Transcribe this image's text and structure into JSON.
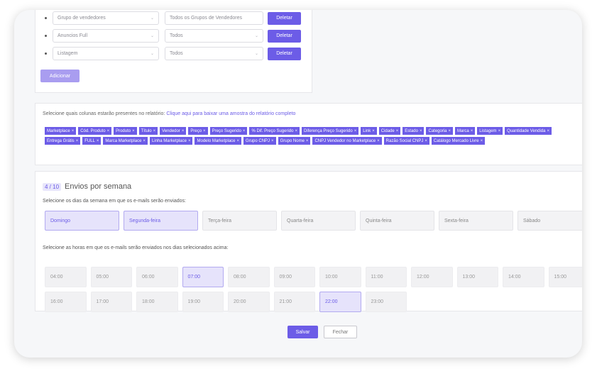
{
  "filters": [
    {
      "field": "Grupo de vendedores",
      "value": "Todos os Grupos de Vendedores",
      "delete_label": "Deletar"
    },
    {
      "field": "Anuncios Full",
      "value": "Todos",
      "delete_label": "Deletar"
    },
    {
      "field": "Listagem",
      "value": "Todos",
      "delete_label": "Deletar"
    }
  ],
  "add_label": "Adicionar",
  "columns": {
    "title": "Selecione quais colunas estarão presentes no relatório:",
    "link": "Clique aqui para baixar uma amostra do relatório completo",
    "tags": [
      "Marketplace",
      "Cód. Produto",
      "Produto",
      "Título",
      "Vendedor",
      "Preço",
      "Preço Sugerido",
      "% Dif. Preço Sugerido",
      "Diferença Preço Sugerido",
      "Link",
      "Cidade",
      "Estado",
      "Categoria",
      "Marca",
      "Listagem",
      "Quantidade Vendida",
      "Entrega Grátis",
      "FULL",
      "Marca Marketplace",
      "Linha Marketplace",
      "Modelo Marketplace",
      "Grupo CNPJ",
      "Grupo Nome",
      "CNPJ Vendedor no Marketplace",
      "Razão Social CNPJ",
      "Catálogo Mercado Livre"
    ]
  },
  "schedule": {
    "badge": "4 / 10",
    "title": "Envios por semana",
    "days_label": "Selecione os dias da semana em que os e-mails serão enviados:",
    "days": [
      {
        "label": "Domingo",
        "selected": true
      },
      {
        "label": "Segunda-feira",
        "selected": true
      },
      {
        "label": "Terça-feira",
        "selected": false
      },
      {
        "label": "Quarta-feira",
        "selected": false
      },
      {
        "label": "Quinta-feira",
        "selected": false
      },
      {
        "label": "Sexta-feira",
        "selected": false
      },
      {
        "label": "Sábado",
        "selected": false
      }
    ],
    "hours_label": "Selecione as horas em que os e-mails serão enviados nos dias selecionados acima:",
    "hours": [
      {
        "label": "04:00",
        "selected": false
      },
      {
        "label": "05:00",
        "selected": false
      },
      {
        "label": "06:00",
        "selected": false
      },
      {
        "label": "07:00",
        "selected": true
      },
      {
        "label": "08:00",
        "selected": false
      },
      {
        "label": "09:00",
        "selected": false
      },
      {
        "label": "10:00",
        "selected": false
      },
      {
        "label": "11:00",
        "selected": false
      },
      {
        "label": "12:00",
        "selected": false
      },
      {
        "label": "13:00",
        "selected": false
      },
      {
        "label": "14:00",
        "selected": false
      },
      {
        "label": "15:00",
        "selected": false
      },
      {
        "label": "16:00",
        "selected": false
      },
      {
        "label": "17:00",
        "selected": false
      },
      {
        "label": "18:00",
        "selected": false
      },
      {
        "label": "19:00",
        "selected": false
      },
      {
        "label": "20:00",
        "selected": false
      },
      {
        "label": "21:00",
        "selected": false
      },
      {
        "label": "22:00",
        "selected": true
      },
      {
        "label": "23:00",
        "selected": false
      }
    ]
  },
  "footer": {
    "save_label": "Salvar",
    "close_label": "Fechar"
  },
  "colors": {
    "accent": "#6c5ce7",
    "accent_light": "#e6e3fb"
  }
}
